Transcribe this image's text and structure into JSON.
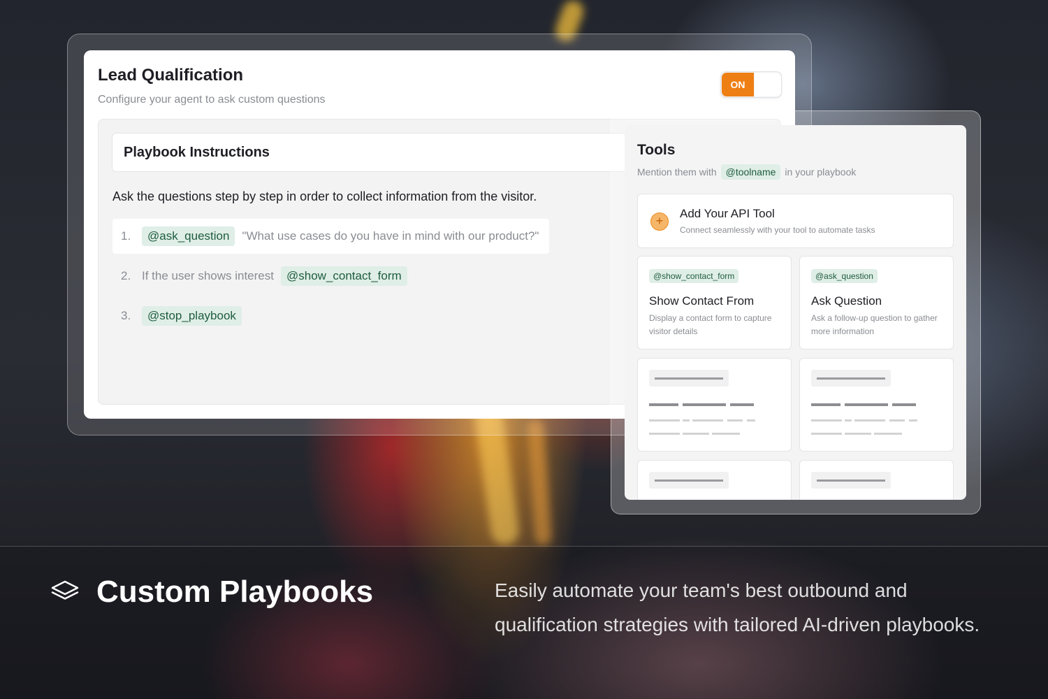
{
  "lead": {
    "title": "Lead Qualification",
    "subtitle": "Configure your agent to ask custom questions",
    "toggle_label": "ON",
    "toggle_color": "#ee7f14"
  },
  "playbook": {
    "header": "Playbook Instructions",
    "instruction": "Ask the questions step by step in order to collect information from the visitor.",
    "steps": [
      {
        "num": "1.",
        "tag": "@ask_question",
        "quote": "\"What use cases do you have in mind with our product?\""
      },
      {
        "num": "2.",
        "text": "If the user shows interest",
        "tag": "@show_contact_form"
      },
      {
        "num": "3.",
        "tag": "@stop_playbook"
      }
    ]
  },
  "tools": {
    "title": "Tools",
    "sub_prefix": "Mention them with",
    "sub_tag": "@toolname",
    "sub_suffix": "in your playbook",
    "api": {
      "icon": "plus-circle-icon",
      "title": "Add Your API Tool",
      "desc": "Connect seamlessly with your tool to automate tasks"
    },
    "cards": [
      {
        "tag": "@show_contact_form",
        "name": "Show Contact From",
        "desc": "Display a contact form to capture visitor details"
      },
      {
        "tag": "@ask_question",
        "name": "Ask Question",
        "desc": "Ask a follow-up question to gather more information"
      }
    ]
  },
  "banner": {
    "icon": "layers-icon",
    "title": "Custom Playbooks",
    "desc": "Easily automate your team's best outbound and qualification strategies with tailored AI-driven playbooks."
  },
  "colors": {
    "tag_bg": "#dfeee6",
    "tag_text": "#1f5c40",
    "accent": "#ee7f14"
  }
}
